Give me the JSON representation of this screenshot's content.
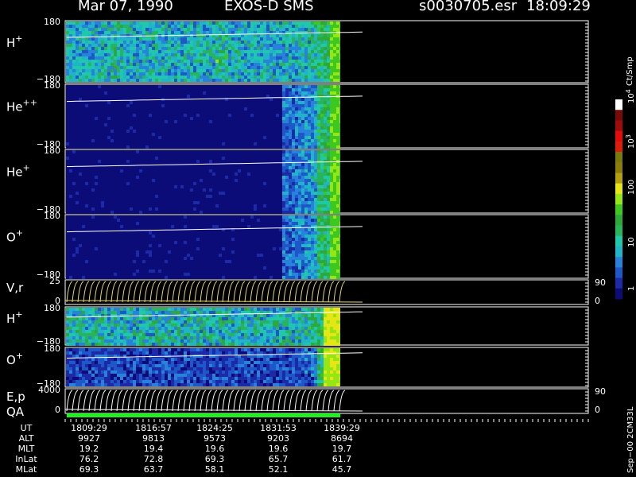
{
  "header": {
    "date": "Mar 07, 1990",
    "instrument": "EXOS-D SMS",
    "file": "s0030705.esr",
    "time": "18:09:29"
  },
  "colors": {
    "background": "#000000",
    "trace": "#ffffff",
    "velocity_trace": "#e8d870",
    "qa_bar": "#22ee22",
    "spectrogram_base": "#14147a"
  },
  "chart_data": {
    "type": "heatmap",
    "panels": [
      {
        "label": "H",
        "label_sup": "+",
        "ymax": "180",
        "ymin": "−180"
      },
      {
        "label": "He",
        "label_sup": "++",
        "ymax": "180",
        "ymin": "−180"
      },
      {
        "label": "He",
        "label_sup": "+",
        "ymax": "180",
        "ymin": "−180"
      },
      {
        "label": "O",
        "label_sup": "+",
        "ymax": "180",
        "ymin": "−180"
      },
      {
        "label": "V,r",
        "label_sup": "",
        "ymax": "25",
        "ymin": "0",
        "right_max": "90",
        "right_min": "0"
      },
      {
        "label": "H",
        "label_sup": "+",
        "ymax": "180",
        "ymin": "−180"
      },
      {
        "label": "O",
        "label_sup": "+",
        "ymax": "180",
        "ymin": "−180"
      },
      {
        "label": "E,p",
        "label_sup": "",
        "ymax": "4000",
        "ymin": "0",
        "right_max": "90",
        "right_min": "0"
      },
      {
        "label": "QA",
        "label_sup": ""
      }
    ],
    "colorbar": {
      "unit": "Ct/Smp",
      "tick_labels": [
        {
          "base": "1",
          "exp": ""
        },
        {
          "base": "10",
          "exp": ""
        },
        {
          "base": "100",
          "exp": ""
        },
        {
          "base": "10",
          "exp": "3"
        },
        {
          "base": "10",
          "exp": "4"
        }
      ],
      "levels": [
        "#0c0c78",
        "#1c2aa8",
        "#1e58c8",
        "#2882dc",
        "#20b4c8",
        "#1ec8a8",
        "#28b45a",
        "#2ea838",
        "#3cc81e",
        "#96e614",
        "#e6e614",
        "#b4a00a",
        "#8c7c0a",
        "#787a0a",
        "#dc1e0a",
        "#e60a0a",
        "#a00a0a",
        "#780a0a",
        "#ffffff"
      ]
    },
    "time_axis": {
      "rows": [
        {
          "name": "UT",
          "values": [
            "1809:29",
            "1816:57",
            "1824:25",
            "1831:53",
            "1839:29"
          ]
        },
        {
          "name": "ALT",
          "values": [
            "9927",
            "9813",
            "9573",
            "9203",
            "8694"
          ]
        },
        {
          "name": "MLT",
          "values": [
            "19.2",
            "19.4",
            "19.6",
            "19.6",
            "19.7"
          ]
        },
        {
          "name": "InLat",
          "values": [
            "76.2",
            "72.8",
            "69.3",
            "65.7",
            "61.7"
          ]
        },
        {
          "name": "MLat",
          "values": [
            "69.3",
            "63.7",
            "58.1",
            "52.1",
            "45.7"
          ]
        }
      ]
    },
    "footer_label": "Sep−00  2CM33L"
  }
}
